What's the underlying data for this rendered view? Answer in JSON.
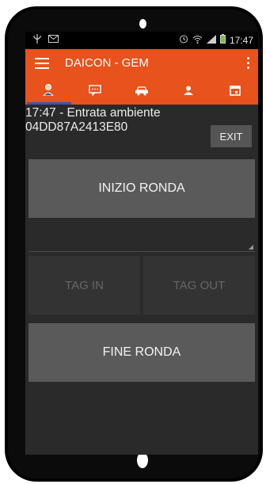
{
  "status_bar": {
    "left_icons": [
      "usb-icon",
      "mail-icon"
    ],
    "right_icons": [
      "alarm-icon",
      "wifi-icon",
      "signal-icon",
      "battery-icon"
    ],
    "time": "17:47"
  },
  "app_bar": {
    "title": "DAICON - GEM"
  },
  "tabs": [
    {
      "icon": "user-icon",
      "active": true
    },
    {
      "icon": "message-icon",
      "active": false
    },
    {
      "icon": "car-icon",
      "active": false
    },
    {
      "icon": "person-icon",
      "active": false
    },
    {
      "icon": "calendar-icon",
      "active": false
    }
  ],
  "info": {
    "line1": "17:47 - Entrata ambiente",
    "line2": "04DD87A2413E80"
  },
  "buttons": {
    "exit": "EXIT",
    "start_round": "INIZIO RONDA",
    "tag_in": "TAG IN",
    "tag_out": "TAG OUT",
    "end_round": "FINE RONDA"
  },
  "colors": {
    "accent": "#e8521c",
    "tab_indicator": "#3f51b5",
    "screen_bg": "#2a2a2a",
    "button_bg": "#5a5a5a",
    "disabled_button_bg": "#333333"
  }
}
